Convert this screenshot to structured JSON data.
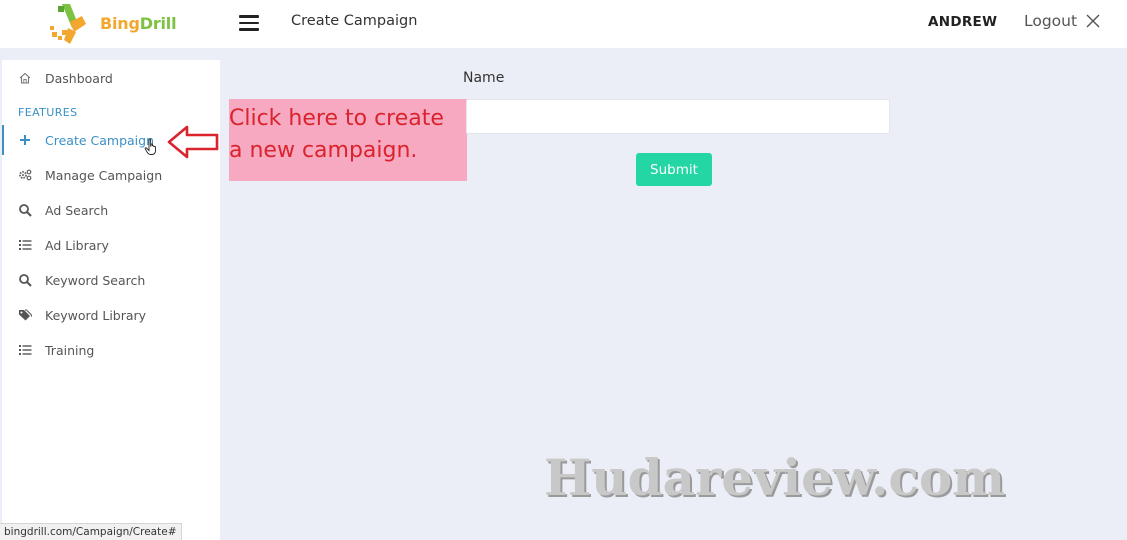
{
  "header": {
    "logo_text_part1": "Bing",
    "logo_text_part2": "Drill",
    "page_title": "Create Campaign",
    "user_name": "ANDREW",
    "logout_label": "Logout"
  },
  "sidebar": {
    "section_label": "FEATURES",
    "items": [
      {
        "label": "Dashboard",
        "icon": "home-icon"
      },
      {
        "label": "Create Campaign",
        "icon": "plus-icon",
        "active": true
      },
      {
        "label": "Manage Campaign",
        "icon": "gears-icon"
      },
      {
        "label": "Ad Search",
        "icon": "search-icon"
      },
      {
        "label": "Ad Library",
        "icon": "list-icon"
      },
      {
        "label": "Keyword Search",
        "icon": "search-icon"
      },
      {
        "label": "Keyword Library",
        "icon": "tags-icon"
      },
      {
        "label": "Training",
        "icon": "list-icon"
      }
    ]
  },
  "form": {
    "name_label": "Name",
    "name_value": "",
    "submit_label": "Submit"
  },
  "annotation": {
    "text": "Click here to create\na new campaign."
  },
  "watermark": "Hudareview.com",
  "status_url": "bingdrill.com/Campaign/Create#",
  "colors": {
    "accent": "#3b8fc7",
    "submit": "#23d6a4",
    "callout_bg": "#f6a9c0",
    "callout_text": "#d9232d",
    "logo_orange": "#f4a72e",
    "logo_green": "#7dc242"
  }
}
